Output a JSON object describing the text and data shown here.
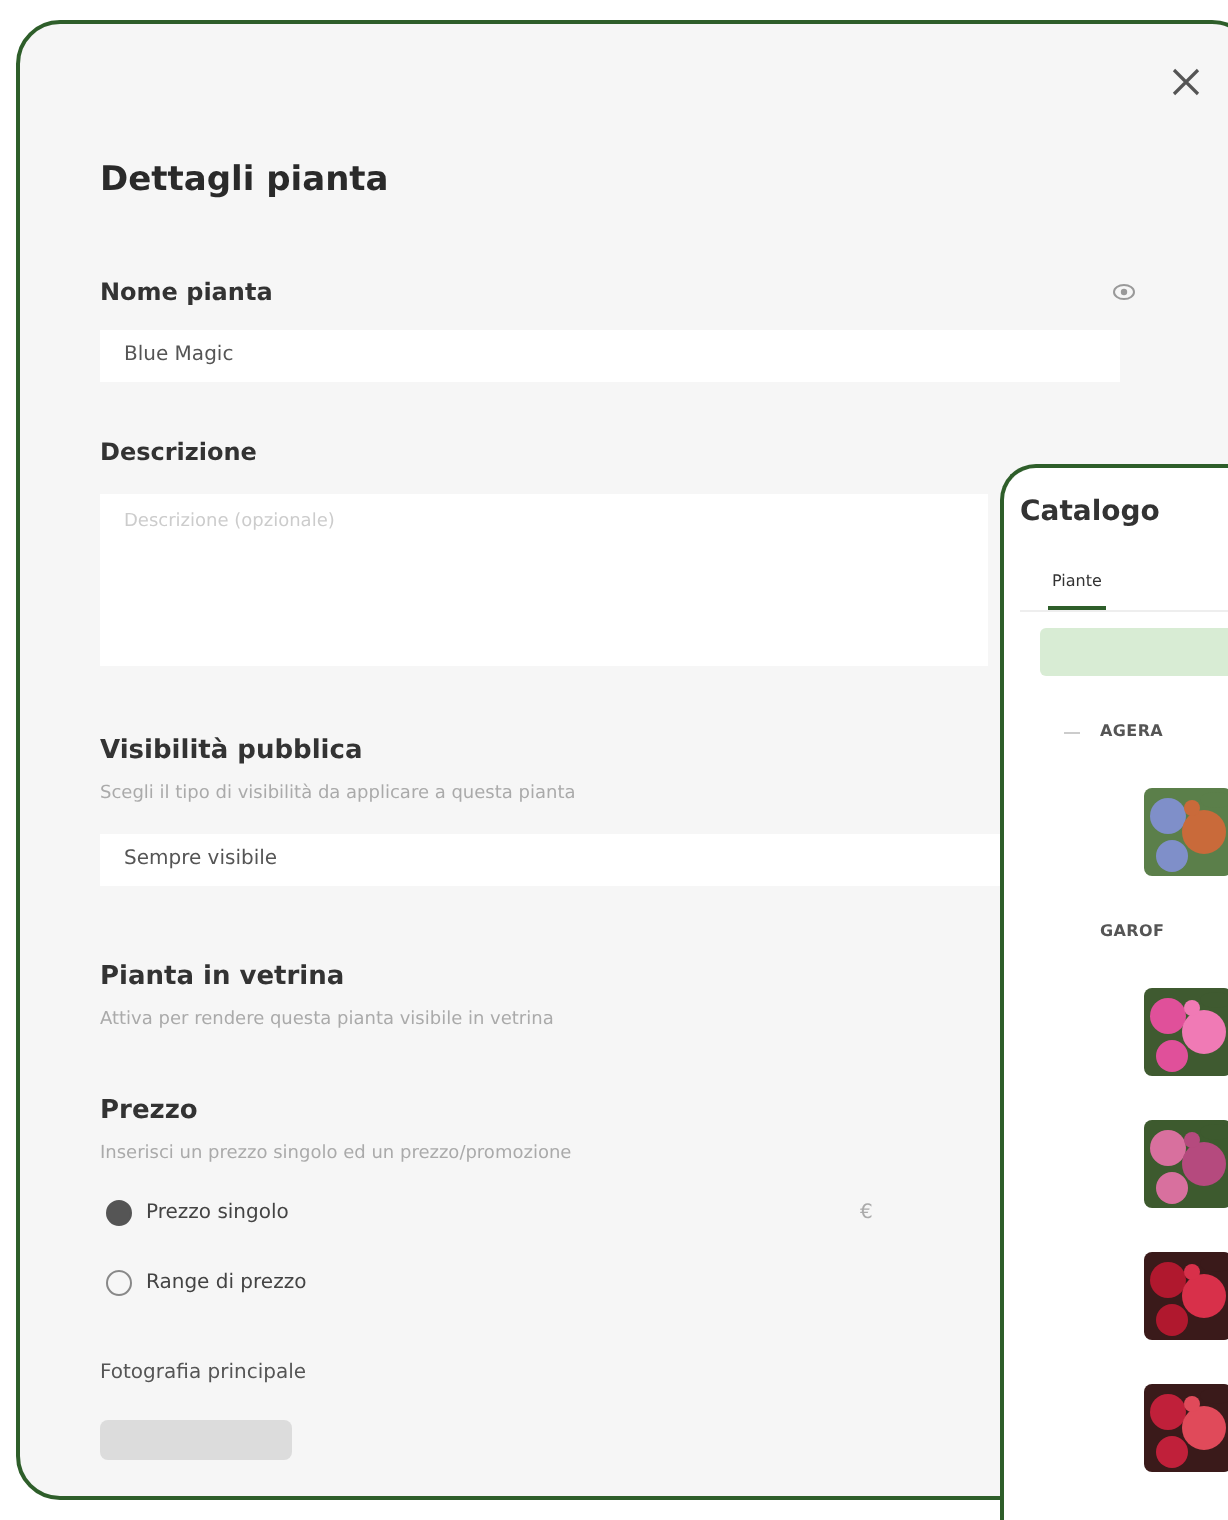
{
  "dialog": {
    "title": "Dettagli pianta",
    "name_field": {
      "label": "Nome pianta",
      "value": "Blue Magic"
    },
    "description_field": {
      "label": "Descrizione",
      "placeholder": "Descrizione (opzionale)"
    },
    "visibility": {
      "title": "Visibilità pubblica",
      "hint": "Scegli il tipo di visibilità da applicare a questa pianta",
      "value": "Sempre visibile"
    },
    "showcase": {
      "title": "Pianta in vetrina",
      "hint": "Attiva per rendere questa pianta visibile in vetrina"
    },
    "price": {
      "title": "Prezzo",
      "hint": "Inserisci un prezzo singolo ed un prezzo/promozione",
      "currency": "€",
      "options": [
        {
          "label": "Prezzo singolo",
          "selected": true
        },
        {
          "label": "Range di prezzo",
          "selected": false
        }
      ]
    },
    "photo": {
      "label": "Fotografia principale"
    }
  },
  "catalog": {
    "title": "Catalogo",
    "tabs": [
      {
        "label": "Piante",
        "selected": true
      }
    ],
    "groups": [
      {
        "name": "AGERA"
      },
      {
        "name": "GAROF"
      }
    ]
  }
}
